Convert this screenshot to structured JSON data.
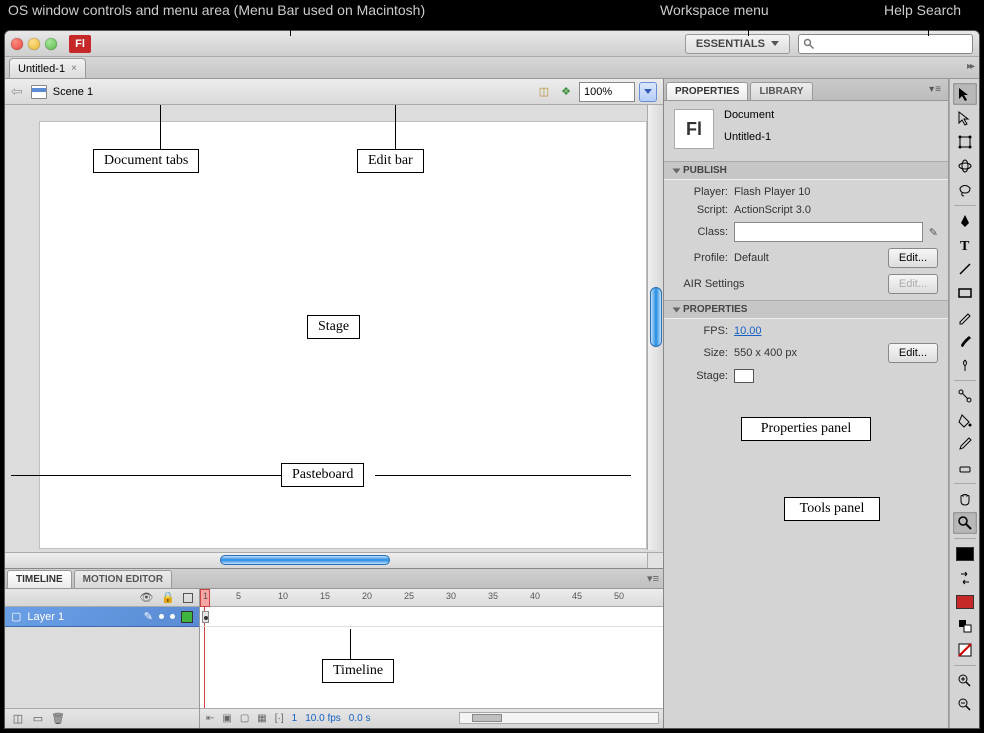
{
  "annotations": {
    "os_controls": "OS window controls and menu area (Menu Bar used on Macintosh)",
    "workspace_menu": "Workspace menu",
    "help_search": "Help Search",
    "document_tabs": "Document tabs",
    "edit_bar": "Edit bar",
    "stage": "Stage",
    "pasteboard": "Pasteboard",
    "timeline": "Timeline",
    "properties_panel": "Properties panel",
    "tools_panel": "Tools panel"
  },
  "titlebar": {
    "app_badge": "Fl",
    "workspace_label": "ESSENTIALS",
    "search_placeholder": ""
  },
  "doctab": {
    "name": "Untitled-1"
  },
  "editbar": {
    "scene_label": "Scene 1",
    "zoom": "100%"
  },
  "panels": {
    "timeline_tab": "TIMELINE",
    "motion_editor_tab": "MOTION EDITOR",
    "properties_tab": "PROPERTIES",
    "library_tab": "LIBRARY"
  },
  "timeline": {
    "layer_name": "Layer 1",
    "ruler_marks": [
      "1",
      "5",
      "10",
      "15",
      "20",
      "25",
      "30",
      "35",
      "40",
      "45",
      "50"
    ],
    "current_frame": "1",
    "fps_display": "10.0 fps",
    "time_display": "0.0 s"
  },
  "properties": {
    "doc_type": "Document",
    "doc_name": "Untitled-1",
    "publish_section": "PUBLISH",
    "player_label": "Player:",
    "player_value": "Flash Player 10",
    "script_label": "Script:",
    "script_value": "ActionScript 3.0",
    "class_label": "Class:",
    "class_value": "",
    "profile_label": "Profile:",
    "profile_value": "Default",
    "air_label": "AIR Settings",
    "edit_btn": "Edit...",
    "props_section": "PROPERTIES",
    "fps_label": "FPS:",
    "fps_value": "10.00",
    "size_label": "Size:",
    "size_value": "550 x 400 px",
    "stage_label": "Stage:"
  }
}
